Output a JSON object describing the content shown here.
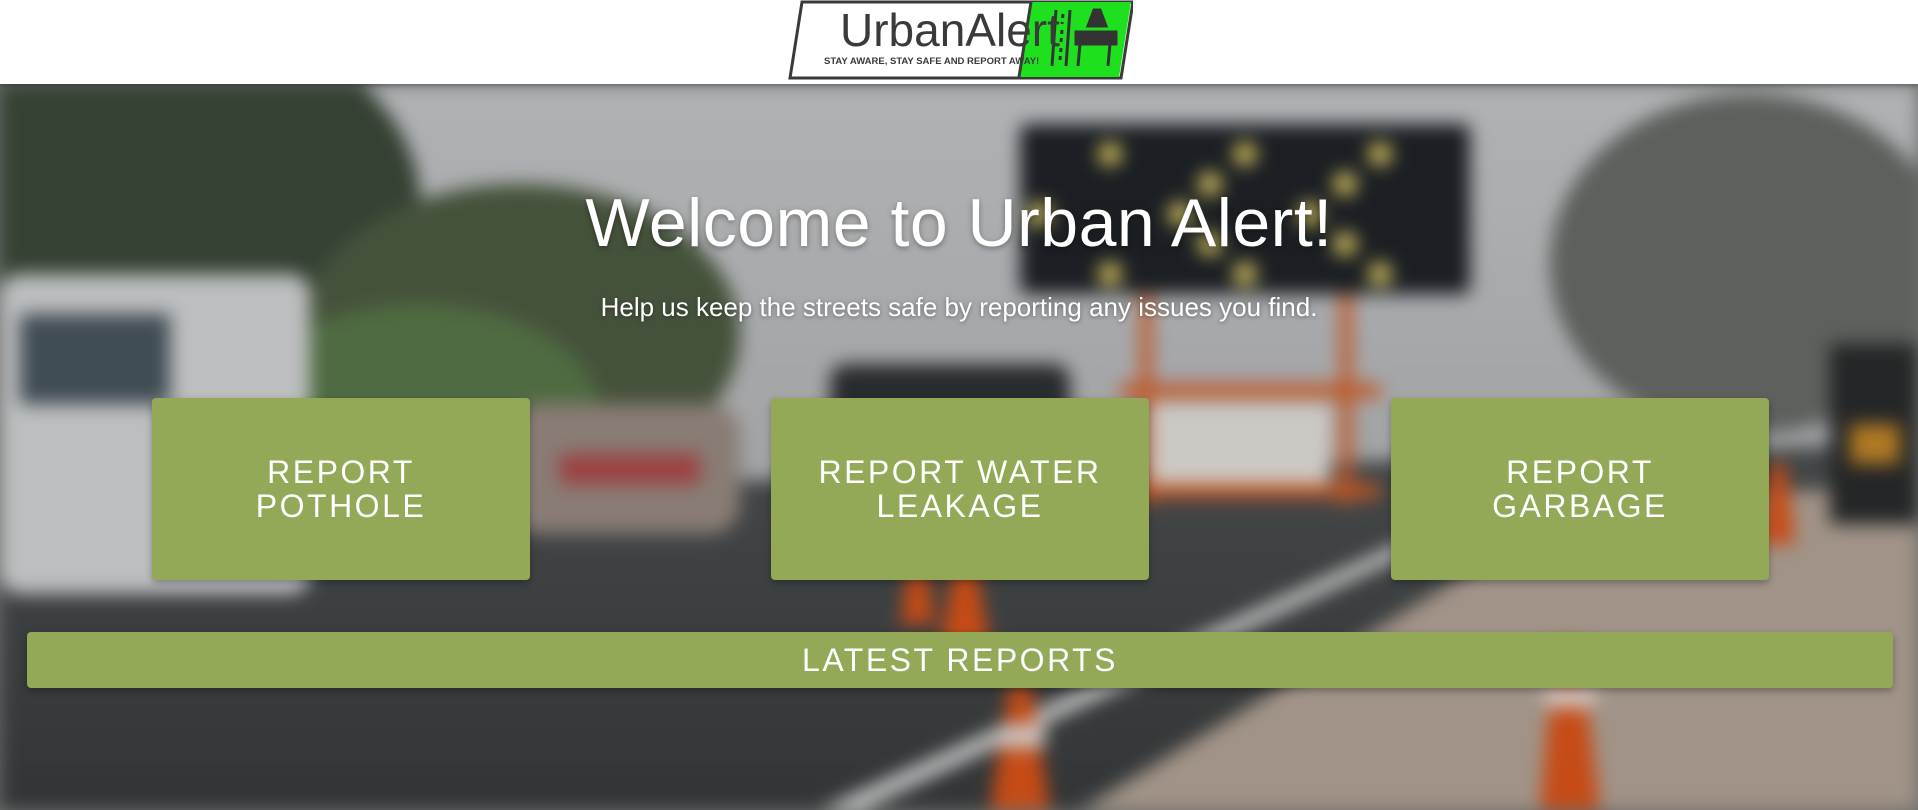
{
  "header": {
    "logo_name": "UrbanAlert",
    "logo_tagline": "STAY AWARE, STAY SAFE AND REPORT AWAY!",
    "logo_accent_color": "#1ee01e"
  },
  "hero": {
    "title": "Welcome to Urban Alert!",
    "subtitle": "Help us keep the streets safe by reporting any issues you find."
  },
  "actions": [
    {
      "label": "REPORT POTHOLE"
    },
    {
      "label": "REPORT WATER LEAKAGE"
    },
    {
      "label": "REPORT GARBAGE"
    }
  ],
  "latest_reports": {
    "label": "LATEST REPORTS"
  },
  "colors": {
    "button_green": "#93a957",
    "text_white": "#ffffff"
  }
}
